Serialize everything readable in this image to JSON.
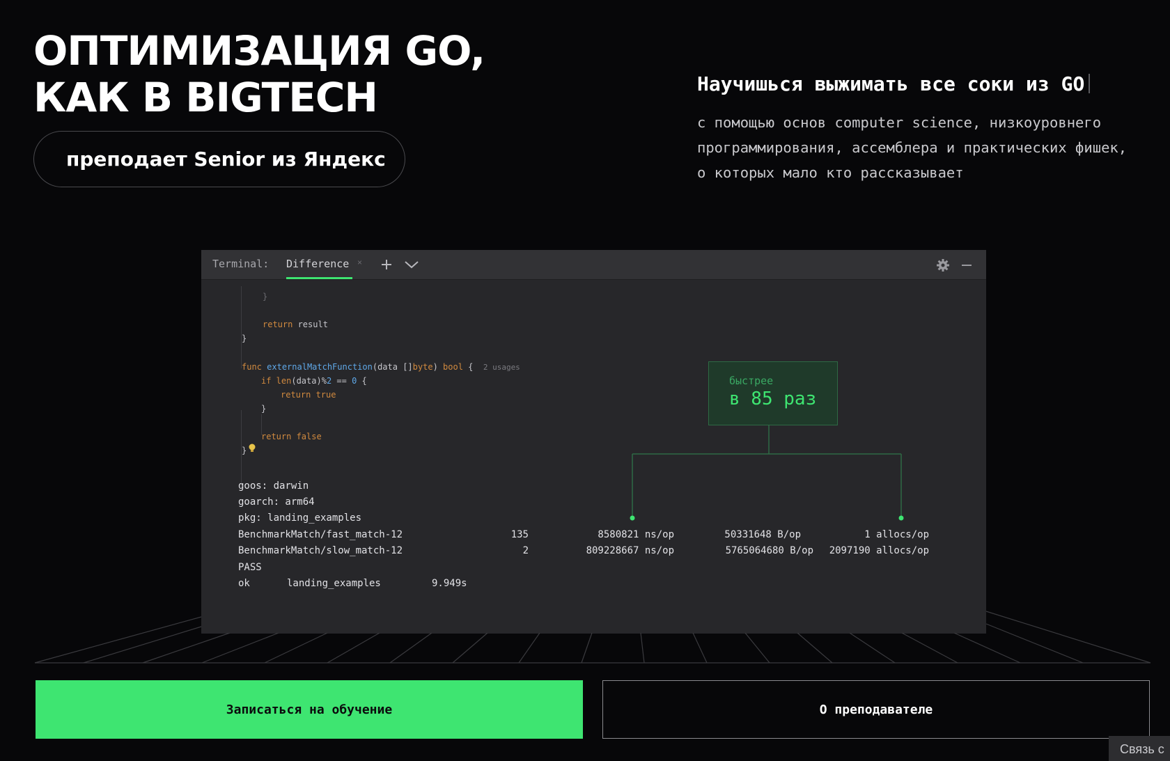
{
  "hero": {
    "title_line1": "ОПТИМИЗАЦИЯ GO,",
    "title_line2": "КАК В BIGTECH",
    "pill": "преподает Senior из Яндекс"
  },
  "intro": {
    "tagline": "Научишься выжимать все соки из GO",
    "description": "с помощью основ computer science, низкоуровнего программирования, ассемблера и практических фишек, о которых мало кто рассказывает"
  },
  "terminal": {
    "label": "Terminal:",
    "tab": "Difference",
    "tab_close": "×",
    "icons": [
      "plus-icon",
      "chevron-down-icon",
      "gear-icon",
      "minimize-icon"
    ],
    "code": {
      "brace1": "}",
      "return_result_kw": "return",
      "return_result_val": " result",
      "brace2": "}",
      "func_kw": "func",
      "func_name": "externalMatchFunction",
      "func_params_a": "(data []",
      "func_params_type": "byte",
      "func_params_b": ") ",
      "func_ret": "bool",
      "func_brace": " {",
      "usages": "2 usages",
      "if_kw": "if",
      "if_fn": " len",
      "if_mid": "(data)%",
      "if_num1": "2",
      "if_eq": " == ",
      "if_num2": "0",
      "if_brace": " {",
      "return_true": "return true",
      "brace3": "}",
      "return_false": "return false",
      "brace4": "}"
    },
    "bench": {
      "goos": "goos: darwin",
      "goarch": "goarch: arm64",
      "pkg": "pkg: landing_examples",
      "rows": [
        {
          "name": "BenchmarkMatch/fast_match-12",
          "n": "135",
          "ns": "8580821 ns/op",
          "bytes": "50331648 B/op",
          "allocs": "1 allocs/op"
        },
        {
          "name": "BenchmarkMatch/slow_match-12",
          "n": "2",
          "ns": "809228667 ns/op",
          "bytes": "5765064680 B/op",
          "allocs": "2097190 allocs/op"
        }
      ],
      "pass": "PASS",
      "ok": "ok",
      "ok_pkg": "landing_examples",
      "ok_time": "9.949s"
    },
    "callout": {
      "small": "быстрее",
      "big": "в 85 раз"
    }
  },
  "cta": {
    "primary": "Записаться на обучение",
    "secondary": "О преподавателе"
  },
  "contact": "Связь с"
}
